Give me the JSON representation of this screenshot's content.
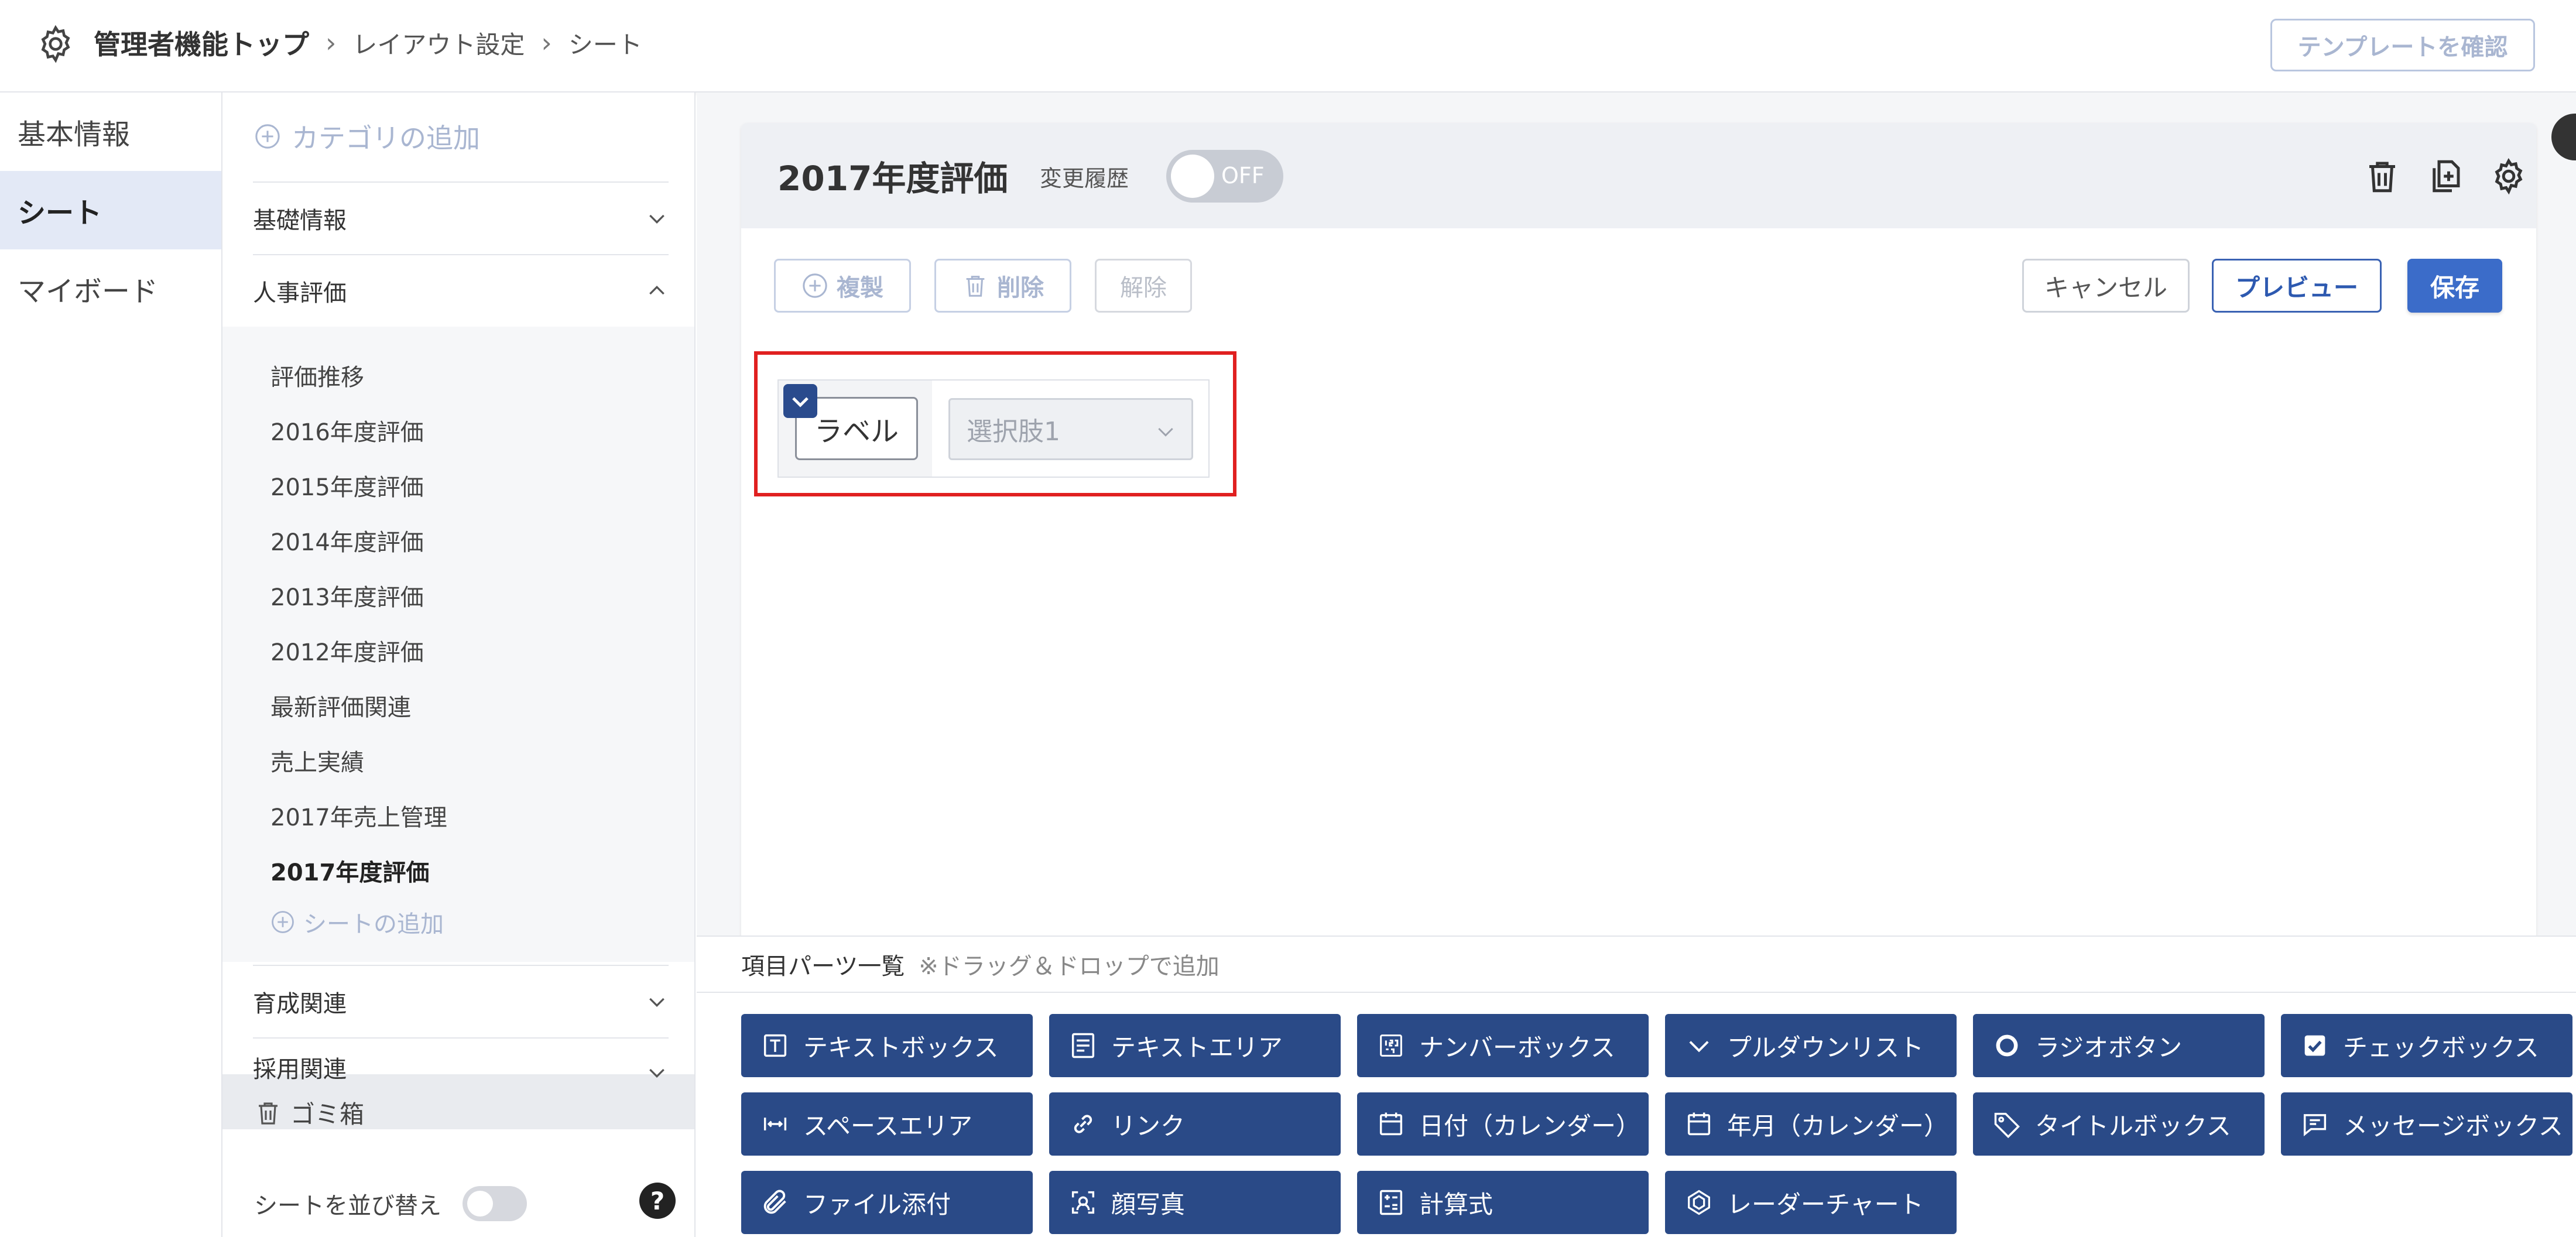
{
  "header": {
    "breadcrumb": [
      "管理者機能トップ",
      "レイアウト設定",
      "シート"
    ],
    "template_button": "テンプレートを確認"
  },
  "leftnav": {
    "items": [
      "基本情報",
      "シート",
      "マイボード"
    ],
    "active": "シート"
  },
  "categories": {
    "add_label": "カテゴリの追加",
    "cat_basic": "基礎情報",
    "cat_hr": "人事評価",
    "sheets": [
      "評価推移",
      "2016年度評価",
      "2015年度評価",
      "2014年度評価",
      "2013年度評価",
      "2012年度評価",
      "最新評価関連",
      "売上実績",
      "2017年売上管理",
      "2017年度評価"
    ],
    "active_sheet": "2017年度評価",
    "add_sheet_label": "シートの追加",
    "cat_training": "育成関連",
    "cat_recruit": "採用関連",
    "trash_label": "ゴミ箱",
    "sort_label": "シートを並び替え",
    "help": "?"
  },
  "sheet": {
    "title": "2017年度評価",
    "history_label": "変更履歴",
    "history_toggle": "OFF",
    "duplicate": "複製",
    "delete": "削除",
    "release": "解除",
    "cancel": "キャンセル",
    "preview": "プレビュー",
    "save": "保存",
    "field_label": "ラベル",
    "select_value": "選択肢1"
  },
  "parts": {
    "title": "項目パーツ一覧",
    "note": "※ドラッグ＆ドロップで追加",
    "items": [
      "テキストボックス",
      "テキストエリア",
      "ナンバーボックス",
      "プルダウンリスト",
      "ラジオボタン",
      "チェックボックス",
      "スペースエリア",
      "リンク",
      "日付（カレンダー）",
      "年月（カレンダー）",
      "タイトルボックス",
      "メッセージボックス",
      "ファイル添付",
      "顔写真",
      "計算式",
      "レーダーチャート"
    ]
  },
  "colors": {
    "accent": "#2a4a87",
    "primary": "#3b6cc9",
    "selection": "#e02020"
  }
}
